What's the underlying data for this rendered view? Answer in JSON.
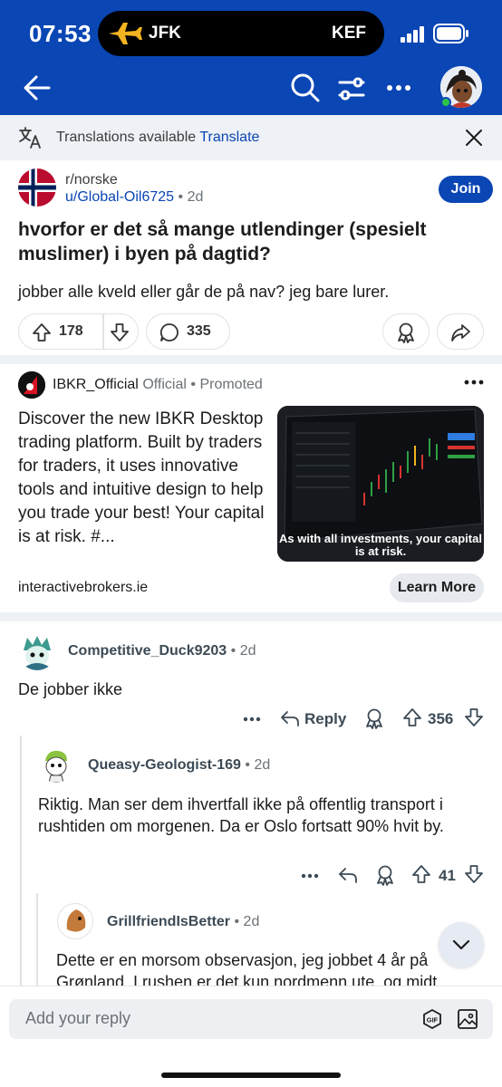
{
  "status_bar": {
    "time": "07:53",
    "flight": {
      "from": "JFK",
      "to": "KEF"
    }
  },
  "header": {
    "icons": [
      "back-arrow-icon",
      "search-icon",
      "filter-icon",
      "more-icon",
      "profile-avatar"
    ],
    "accent": "#0a46b4"
  },
  "translation_bar": {
    "text": "Translations available",
    "link": "Translate"
  },
  "post": {
    "subreddit": "r/norske",
    "author": "u/Global-Oil6725",
    "age": "2d",
    "join_label": "Join",
    "title": "hvorfor er det så mange utlendinger (spesielt muslimer) i byen på dagtid?",
    "body": "jobber alle kveld eller går de på nav? jeg bare lurer.",
    "upvotes": "178",
    "comments": "335"
  },
  "ad": {
    "brand": "IBKR_Official",
    "official": "Official",
    "promoted": "Promoted",
    "text": "Discover the new IBKR Desktop trading platform. Built by traders for traders, it uses innovative tools and intuitive design to help you trade your best! Your capital is at risk. #...",
    "image_caption": "As with all investments, your capital is at risk.",
    "domain": "interactivebrokers.ie",
    "cta": "Learn More"
  },
  "comments": [
    {
      "author": "Competitive_Duck9203",
      "age": "2d",
      "text": "De jobber ikke",
      "reply_label": "Reply",
      "score": "356"
    },
    {
      "author": "Queasy-Geologist-169",
      "age": "2d",
      "text": "Riktig. Man ser dem ihvertfall ikke på offentlig transport i rushtiden om morgenen. Da er Oslo fortsatt 90% hvit by.",
      "score": "41"
    },
    {
      "author": "GrillfriendIsBetter",
      "age": "2d",
      "text": "Dette er en morsom observasjon, jeg jobbet 4 år på Grønland. I rushen er det kun nordmenn ute, og midt"
    }
  ],
  "reply_bar": {
    "placeholder": "Add your reply"
  }
}
